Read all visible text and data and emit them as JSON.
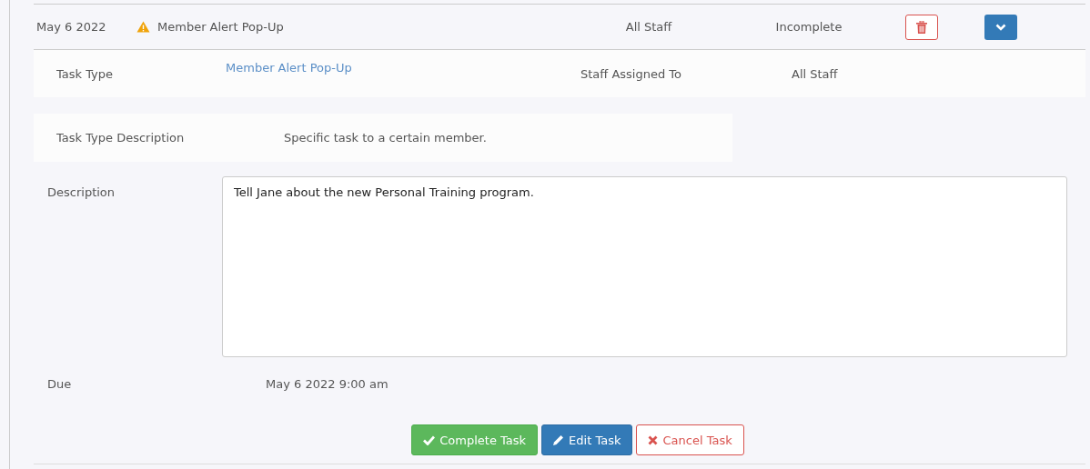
{
  "task": {
    "date": "May 6 2022",
    "title": "Member Alert Pop-Up",
    "assigned": "All Staff",
    "status": "Incomplete"
  },
  "details": {
    "task_type_label": "Task Type",
    "task_type": "Member Alert Pop-Up",
    "staff_label": "Staff Assigned To",
    "staff": "All Staff",
    "type_desc_label": "Task Type Description",
    "type_desc": "Specific task to a certain member.",
    "description_label": "Description",
    "description": "Tell Jane about the new Personal Training program.",
    "due_label": "Due",
    "due": "May 6 2022 9:00 am"
  },
  "buttons": [
    {
      "kind": "complete",
      "label": "Complete Task"
    },
    {
      "kind": "edit",
      "label": "Edit Task"
    },
    {
      "kind": "cancel",
      "label": "Cancel Task"
    }
  ]
}
